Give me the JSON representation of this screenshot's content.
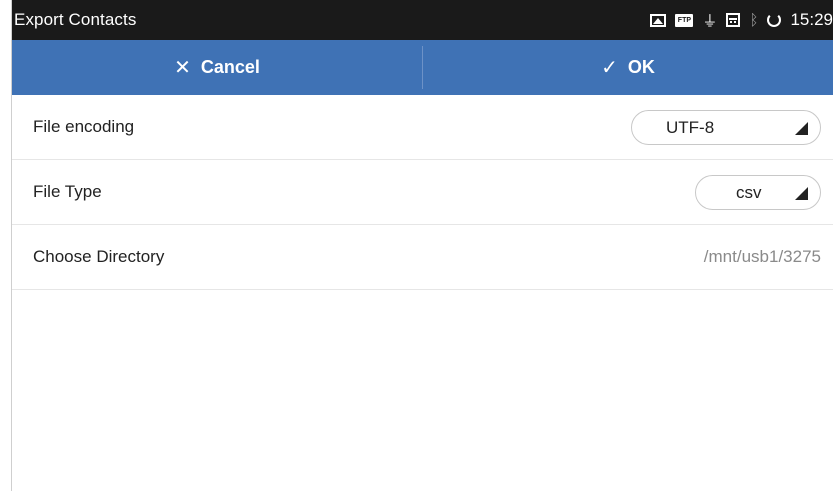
{
  "status_bar": {
    "title": "Export Contacts",
    "time": "15:29",
    "icons": [
      "image-icon",
      "ftp-icon",
      "usb-icon",
      "calendar-icon",
      "bluetooth-icon",
      "sync-icon"
    ]
  },
  "action_bar": {
    "cancel_label": "Cancel",
    "ok_label": "OK",
    "accent_color": "#3f72b5"
  },
  "settings": {
    "file_encoding": {
      "label": "File encoding",
      "value": "UTF-8"
    },
    "file_type": {
      "label": "File Type",
      "value": "csv"
    },
    "choose_directory": {
      "label": "Choose Directory",
      "value": "/mnt/usb1/3275"
    }
  }
}
